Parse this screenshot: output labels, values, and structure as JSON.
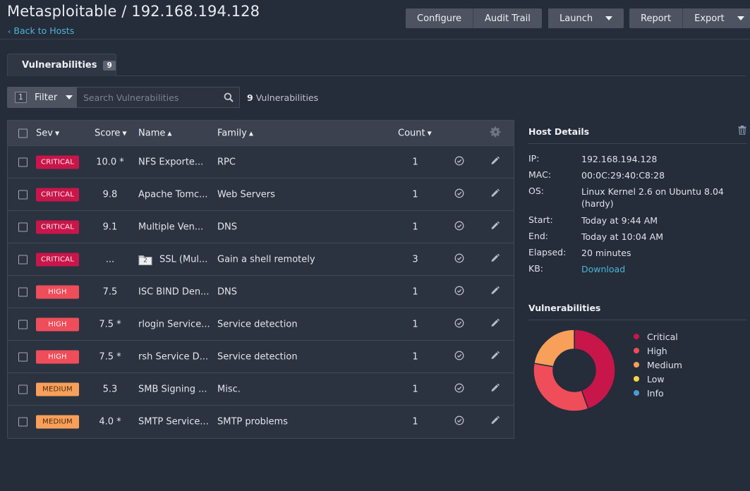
{
  "header": {
    "title": "Metasploitable / 192.168.194.128",
    "back_label": "Back to Hosts"
  },
  "toolbar": {
    "configure": "Configure",
    "audit_trail": "Audit Trail",
    "launch": "Launch",
    "report": "Report",
    "export": "Export"
  },
  "tabs": [
    {
      "label": "Vulnerabilities",
      "count": "9"
    }
  ],
  "filter": {
    "count": "1",
    "label": "Filter",
    "search_placeholder": "Search Vulnerabilities",
    "result_count": "9",
    "result_label": "Vulnerabilities"
  },
  "table": {
    "columns": {
      "sev": "Sev",
      "score": "Score",
      "name": "Name",
      "family": "Family",
      "count": "Count"
    },
    "rows": [
      {
        "sev": "CRITICAL",
        "level": "critical",
        "score": "10.0 *",
        "name": "NFS Exporte...",
        "family": "RPC",
        "count": "1"
      },
      {
        "sev": "CRITICAL",
        "level": "critical",
        "score": "9.8",
        "name": "Apache Tomc...",
        "family": "Web Servers",
        "count": "1"
      },
      {
        "sev": "CRITICAL",
        "level": "critical",
        "score": "9.1",
        "name": "Multiple Ven...",
        "family": "DNS",
        "count": "1"
      },
      {
        "sev": "CRITICAL",
        "level": "critical",
        "score": "...",
        "name": "SSL (Mul...",
        "group_count": "2",
        "family": "Gain a shell remotely",
        "count": "3"
      },
      {
        "sev": "HIGH",
        "level": "high",
        "score": "7.5",
        "name": "ISC BIND Den...",
        "family": "DNS",
        "count": "1"
      },
      {
        "sev": "HIGH",
        "level": "high",
        "score": "7.5 *",
        "name": "rlogin Service...",
        "family": "Service detection",
        "count": "1"
      },
      {
        "sev": "HIGH",
        "level": "high",
        "score": "7.5 *",
        "name": "rsh Service D...",
        "family": "Service detection",
        "count": "1"
      },
      {
        "sev": "MEDIUM",
        "level": "medium",
        "score": "5.3",
        "name": "SMB Signing ...",
        "family": "Misc.",
        "count": "1"
      },
      {
        "sev": "MEDIUM",
        "level": "medium",
        "score": "4.0 *",
        "name": "SMTP Service...",
        "family": "SMTP problems",
        "count": "1"
      }
    ]
  },
  "host_details": {
    "title": "Host Details",
    "ip_label": "IP:",
    "ip": "192.168.194.128",
    "mac_label": "MAC:",
    "mac": "00:0C:29:40:C8:28",
    "os_label": "OS:",
    "os": "Linux Kernel 2.6 on Ubuntu 8.04 (hardy)",
    "start_label": "Start:",
    "start": "Today at 9:44 AM",
    "end_label": "End:",
    "end": "Today at 10:04 AM",
    "elapsed_label": "Elapsed:",
    "elapsed": "20 minutes",
    "kb_label": "KB:",
    "kb": "Download"
  },
  "vuln_summary": {
    "title": "Vulnerabilities",
    "legend": [
      {
        "label": "Critical",
        "color": "#c8164a"
      },
      {
        "label": "High",
        "color": "#ef4d5a"
      },
      {
        "label": "Medium",
        "color": "#f89f5a"
      },
      {
        "label": "Low",
        "color": "#f6d44a"
      },
      {
        "label": "Info",
        "color": "#4a9bd6"
      }
    ]
  },
  "chart_data": {
    "type": "pie",
    "categories": [
      "Critical",
      "High",
      "Medium",
      "Low",
      "Info"
    ],
    "values": [
      4,
      3,
      2,
      0,
      0
    ],
    "colors": [
      "#c8164a",
      "#ef4d5a",
      "#f89f5a",
      "#f6d44a",
      "#4a9bd6"
    ]
  }
}
